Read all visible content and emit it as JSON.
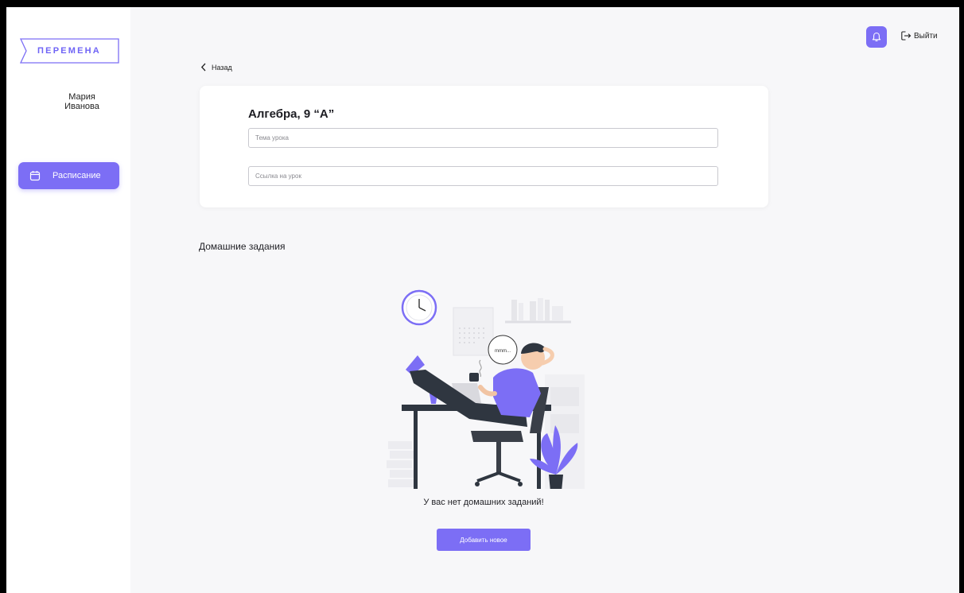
{
  "app": {
    "logo_text": "ПЕРЕМЕНА"
  },
  "user": {
    "first_name": "Мария",
    "last_name": "Иванова"
  },
  "sidebar": {
    "items": [
      {
        "label": "Расписание",
        "icon": "calendar-icon",
        "active": true
      }
    ]
  },
  "header": {
    "notifications_icon": "bell-icon",
    "logout_label": "Выйти"
  },
  "navigation": {
    "back_label": "Назад"
  },
  "lesson": {
    "title": "Алгебра, 9 “А”",
    "topic_placeholder": "Тема урока",
    "link_placeholder": "Ссылка на урок"
  },
  "homework": {
    "section_title": "Домашние задания",
    "empty_message": "У вас нет домашних заданий!",
    "add_button_label": "Добавить новое",
    "speech_bubble_text": "mmm..."
  },
  "colors": {
    "accent": "#7c6ef5",
    "background": "#f7f7f9",
    "surface": "#ffffff"
  }
}
